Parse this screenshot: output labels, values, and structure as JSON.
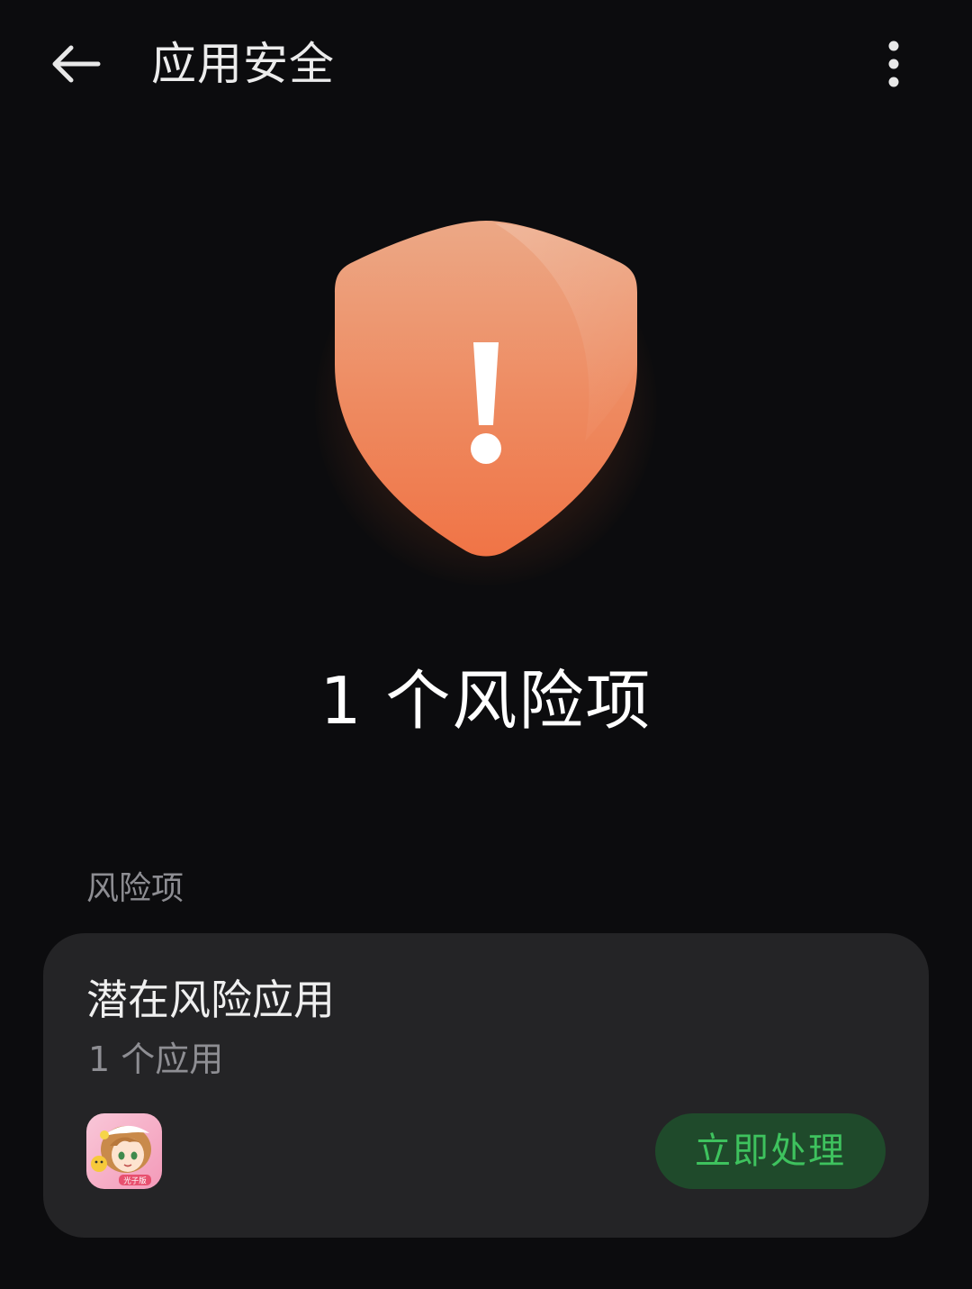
{
  "header": {
    "title": "应用安全",
    "back_icon": "arrow-left-icon",
    "more_icon": "more-vertical-icon"
  },
  "status": {
    "shield_icon": "shield-warning-icon",
    "shield_color": "#f07a4e",
    "risk_count_text": "1 个风险项"
  },
  "section": {
    "label": "风险项"
  },
  "risk_card": {
    "title": "潜在风险应用",
    "subtitle": "1 个应用",
    "app_icon": "app-icon",
    "app_icon_badge": "光子版",
    "action_label": "立即处理",
    "action_color": "#3ec25e"
  }
}
